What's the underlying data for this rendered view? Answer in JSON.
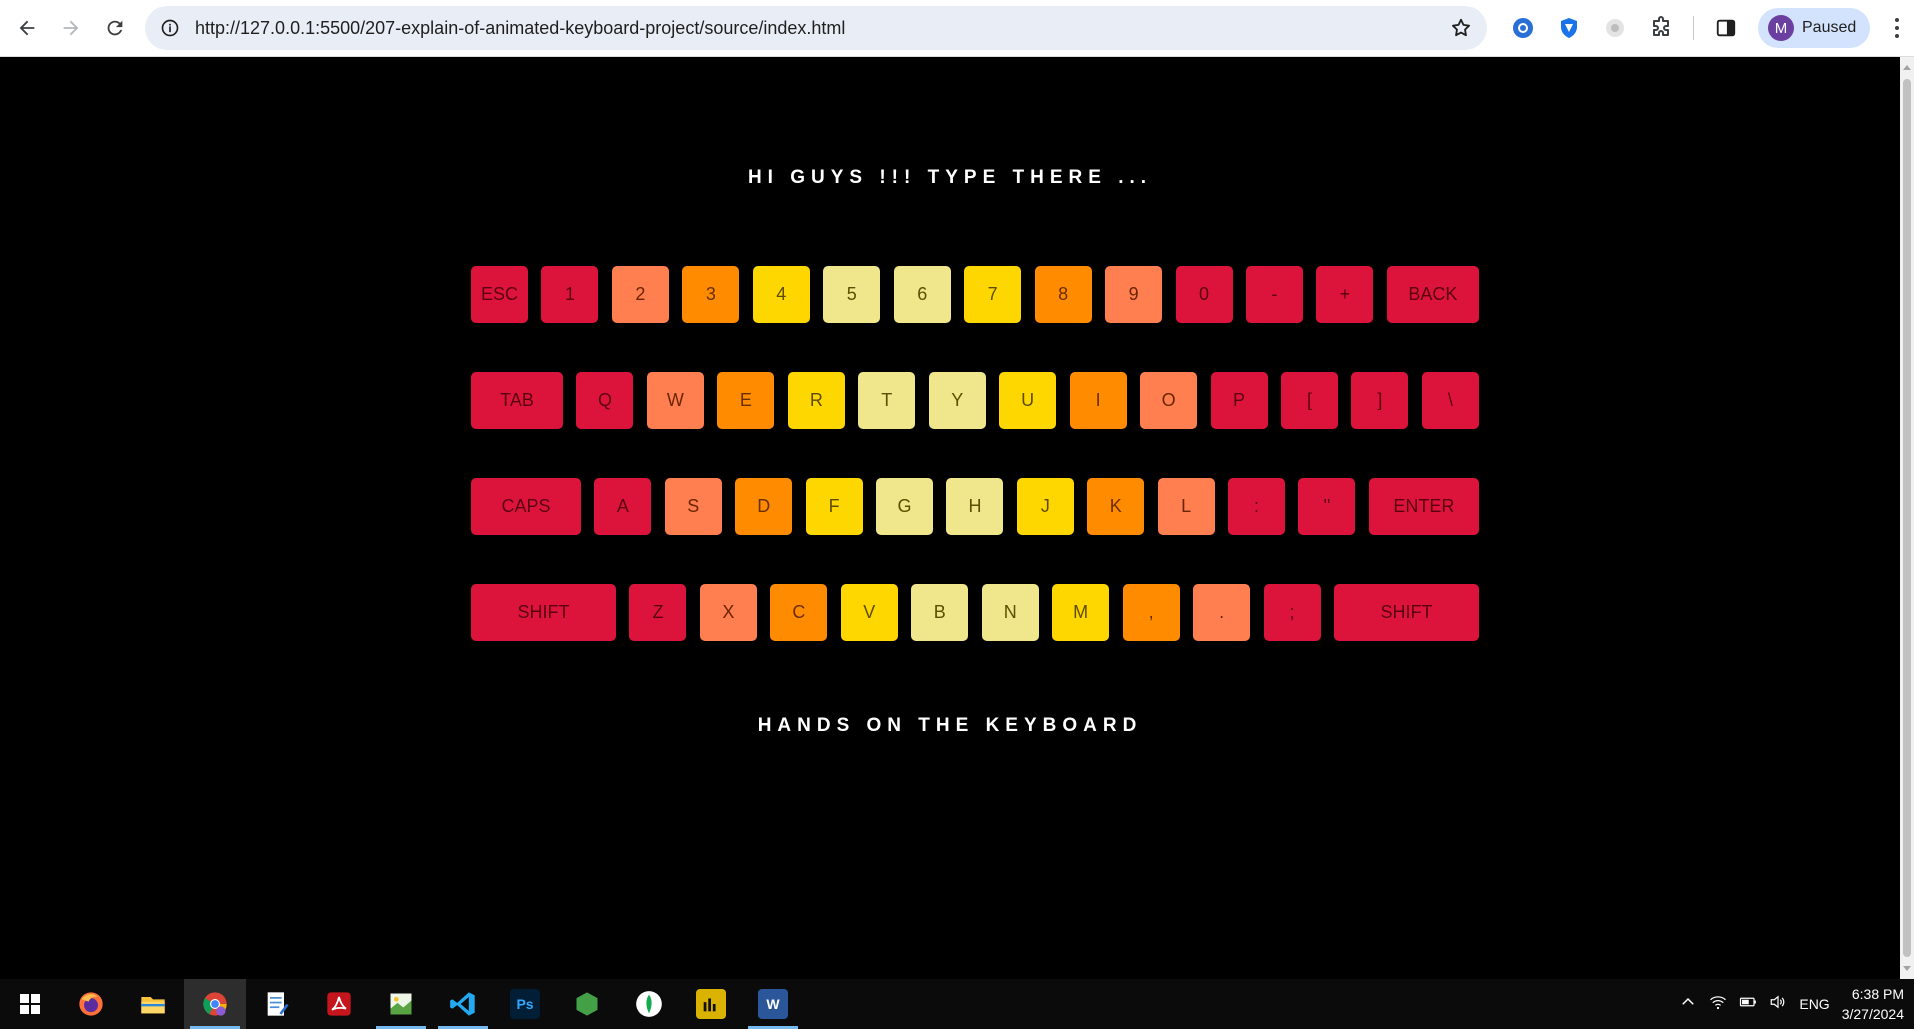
{
  "browser": {
    "url": "http://127.0.0.1:5500/207-explain-of-animated-keyboard-project/source/index.html",
    "profile_initial": "M",
    "profile_label": "Paused"
  },
  "page": {
    "heading": "HI GUYS !!! TYPE THERE ...",
    "footer": "HANDS ON THE KEYBOARD",
    "colors": {
      "red": "#dc143c",
      "coral": "#ff7f50",
      "orange": "#ff8c00",
      "gold": "#ffd700",
      "khaki": "#f0e68c"
    },
    "keyboard": [
      [
        {
          "label": "ESC",
          "color": "red"
        },
        {
          "label": "1",
          "color": "red"
        },
        {
          "label": "2",
          "color": "coral"
        },
        {
          "label": "3",
          "color": "orange"
        },
        {
          "label": "4",
          "color": "gold"
        },
        {
          "label": "5",
          "color": "khaki"
        },
        {
          "label": "6",
          "color": "khaki"
        },
        {
          "label": "7",
          "color": "gold"
        },
        {
          "label": "8",
          "color": "orange"
        },
        {
          "label": "9",
          "color": "coral"
        },
        {
          "label": "0",
          "color": "red"
        },
        {
          "label": "-",
          "color": "red"
        },
        {
          "label": "+",
          "color": "red"
        },
        {
          "label": "BACK",
          "color": "red"
        }
      ],
      [
        {
          "label": "TAB",
          "color": "red"
        },
        {
          "label": "Q",
          "color": "red"
        },
        {
          "label": "W",
          "color": "coral"
        },
        {
          "label": "E",
          "color": "orange"
        },
        {
          "label": "R",
          "color": "gold"
        },
        {
          "label": "T",
          "color": "khaki"
        },
        {
          "label": "Y",
          "color": "khaki"
        },
        {
          "label": "U",
          "color": "gold"
        },
        {
          "label": "I",
          "color": "orange"
        },
        {
          "label": "O",
          "color": "coral"
        },
        {
          "label": "P",
          "color": "red"
        },
        {
          "label": "[",
          "color": "red"
        },
        {
          "label": "]",
          "color": "red"
        },
        {
          "label": "\\",
          "color": "red"
        }
      ],
      [
        {
          "label": "CAPS",
          "color": "red"
        },
        {
          "label": "A",
          "color": "red"
        },
        {
          "label": "S",
          "color": "coral"
        },
        {
          "label": "D",
          "color": "orange"
        },
        {
          "label": "F",
          "color": "gold"
        },
        {
          "label": "G",
          "color": "khaki"
        },
        {
          "label": "H",
          "color": "khaki"
        },
        {
          "label": "J",
          "color": "gold"
        },
        {
          "label": "K",
          "color": "orange"
        },
        {
          "label": "L",
          "color": "coral"
        },
        {
          "label": ":",
          "color": "red"
        },
        {
          "label": "''",
          "color": "red"
        },
        {
          "label": "ENTER",
          "color": "red"
        }
      ],
      [
        {
          "label": "SHIFT",
          "color": "red"
        },
        {
          "label": "Z",
          "color": "red"
        },
        {
          "label": "X",
          "color": "coral"
        },
        {
          "label": "C",
          "color": "orange"
        },
        {
          "label": "V",
          "color": "gold"
        },
        {
          "label": "B",
          "color": "khaki"
        },
        {
          "label": "N",
          "color": "khaki"
        },
        {
          "label": "M",
          "color": "gold"
        },
        {
          "label": ",",
          "color": "orange"
        },
        {
          "label": ".",
          "color": "coral"
        },
        {
          "label": ";",
          "color": "red"
        },
        {
          "label": "SHIFT",
          "color": "red"
        }
      ]
    ]
  },
  "taskbar": {
    "apps": [
      {
        "name": "windows-start-icon"
      },
      {
        "name": "firefox-icon"
      },
      {
        "name": "file-explorer-icon"
      },
      {
        "name": "chrome-icon"
      },
      {
        "name": "notepad-icon"
      },
      {
        "name": "acrobat-icon"
      },
      {
        "name": "paint-icon"
      },
      {
        "name": "vscode-icon"
      },
      {
        "name": "photoshop-icon",
        "text": "Ps"
      },
      {
        "name": "nodejs-icon"
      },
      {
        "name": "mongodb-compass-icon"
      },
      {
        "name": "power-bi-icon"
      },
      {
        "name": "word-icon",
        "text": "W"
      }
    ],
    "language": "ENG",
    "time": "6:38 PM",
    "date": "3/27/2024"
  }
}
